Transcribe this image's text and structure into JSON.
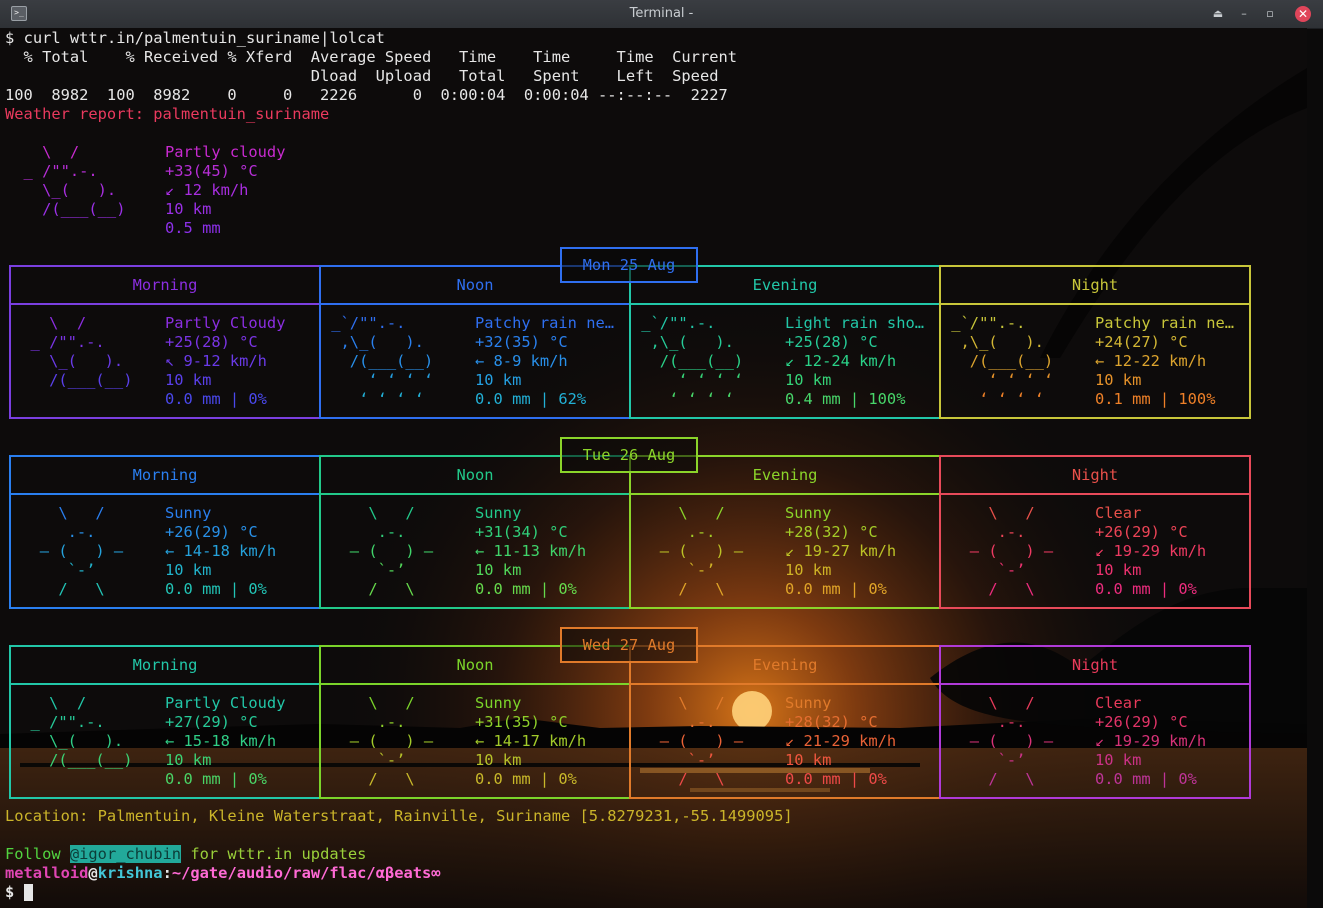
{
  "window": {
    "title": "Terminal -",
    "icon": "terminal-icon",
    "buttons": [
      "up-arrow-icon",
      "minimize-icon",
      "maximize-icon",
      "close-icon"
    ],
    "button_glyphs": [
      "⏏",
      "–",
      "▫",
      "✕"
    ]
  },
  "command": {
    "prompt_symbol": "$",
    "text": "curl wttr.in/palmentuin_suriname|lolcat"
  },
  "curl_progress": {
    "header1": "  % Total    % Received % Xferd  Average Speed   Time    Time     Time  Current",
    "header2": "                                 Dload  Upload   Total   Spent    Left  Speed",
    "values": "100  8982  100  8982    0     0   2226      0  0:00:04  0:00:04 --:--:--  2227"
  },
  "report_title": "Weather report: palmentuin_suriname",
  "current": {
    "art": [
      "    \\  /",
      "  _ /\"\".-.",
      "    \\_(   ).",
      "    /(___(__)"
    ],
    "condition": "Partly cloudy",
    "temperature": "+33(45) °C",
    "wind": "↙ 12 km/h",
    "visibility": "10 km",
    "precipitation": "0.5 mm"
  },
  "forecast": {
    "periods": [
      "Morning",
      "Noon",
      "Evening",
      "Night"
    ],
    "days": [
      {
        "date": "Mon 25 Aug",
        "cells": [
          {
            "art": [
              "    \\  /",
              "  _ /\"\".-.",
              "    \\_(   ).",
              "    /(___(__)",
              ""
            ],
            "lines": [
              "Partly Cloudy",
              "+25(28) °C",
              "↖ 9-12 km/h",
              "10 km",
              "0.0 mm | 0%"
            ]
          },
          {
            "art": [
              " _`/\"\".-.",
              "  ,\\_(   ).",
              "   /(___(__)",
              "     ‘ ‘ ‘ ‘",
              "    ‘ ‘ ‘ ‘"
            ],
            "lines": [
              "Patchy rain ne…",
              "+32(35) °C",
              "← 8-9 km/h",
              "10 km",
              "0.0 mm | 62%"
            ]
          },
          {
            "art": [
              " _`/\"\".-.",
              "  ,\\_(   ).",
              "   /(___(__)",
              "     ‘ ‘ ‘ ‘",
              "    ‘ ‘ ‘ ‘"
            ],
            "lines": [
              "Light rain sho…",
              "+25(28) °C",
              "↙ 12-24 km/h",
              "10 km",
              "0.4 mm | 100%"
            ]
          },
          {
            "art": [
              " _`/\"\".-.",
              "  ,\\_(   ).",
              "   /(___(__)",
              "     ‘ ‘ ‘ ‘",
              "    ‘ ‘ ‘ ‘"
            ],
            "lines": [
              "Patchy rain ne…",
              "+24(27) °C",
              "← 12-22 km/h",
              "10 km",
              "0.1 mm | 100%"
            ]
          }
        ]
      },
      {
        "date": "Tue 26 Aug",
        "cells": [
          {
            "art": [
              "     \\   /",
              "      .-.",
              "   ― (   ) ―",
              "      `-’",
              "     /   \\"
            ],
            "lines": [
              "Sunny",
              "+26(29) °C",
              "← 14-18 km/h",
              "10 km",
              "0.0 mm | 0%"
            ]
          },
          {
            "art": [
              "     \\   /",
              "      .-.",
              "   ― (   ) ―",
              "      `-’",
              "     /   \\"
            ],
            "lines": [
              "Sunny",
              "+31(34) °C",
              "← 11-13 km/h",
              "10 km",
              "0.0 mm | 0%"
            ]
          },
          {
            "art": [
              "     \\   /",
              "      .-.",
              "   ― (   ) ―",
              "      `-’",
              "     /   \\"
            ],
            "lines": [
              "Sunny",
              "+28(32) °C",
              "↙ 19-27 km/h",
              "10 km",
              "0.0 mm | 0%"
            ]
          },
          {
            "art": [
              "     \\   /",
              "      .-.",
              "   ― (   ) ―",
              "      `-’",
              "     /   \\"
            ],
            "lines": [
              "Clear",
              "+26(29) °C",
              "↙ 19-29 km/h",
              "10 km",
              "0.0 mm | 0%"
            ]
          }
        ]
      },
      {
        "date": "Wed 27 Aug",
        "cells": [
          {
            "art": [
              "    \\  /",
              "  _ /\"\".-.",
              "    \\_(   ).",
              "    /(___(__)",
              ""
            ],
            "lines": [
              "Partly Cloudy",
              "+27(29) °C",
              "← 15-18 km/h",
              "10 km",
              "0.0 mm | 0%"
            ]
          },
          {
            "art": [
              "     \\   /",
              "      .-.",
              "   ― (   ) ―",
              "      `-’",
              "     /   \\"
            ],
            "lines": [
              "Sunny",
              "+31(35) °C",
              "← 14-17 km/h",
              "10 km",
              "0.0 mm | 0%"
            ]
          },
          {
            "art": [
              "     \\   /",
              "      .-.",
              "   ― (   ) ―",
              "      `-’",
              "     /   \\"
            ],
            "lines": [
              "Sunny",
              "+28(32) °C",
              "↙ 21-29 km/h",
              "10 km",
              "0.0 mm | 0%"
            ]
          },
          {
            "art": [
              "     \\   /",
              "      .-.",
              "   ― (   ) ―",
              "      `-’",
              "     /   \\"
            ],
            "lines": [
              "Clear",
              "+26(29) °C",
              "↙ 19-29 km/h",
              "10 km",
              "0.0 mm | 0%"
            ]
          }
        ]
      }
    ]
  },
  "location_line": "Location: Palmentuin, Kleine Waterstraat, Rainville, Suriname [5.8279231,-55.1499095]",
  "follow": {
    "prefix": "Follow ",
    "handle": "@igor_chubin",
    "suffix": " for wttr.in updates"
  },
  "prompt": {
    "user": "metalloid",
    "at": "@",
    "host": "krishna",
    "colon": ":",
    "path": "~/gate/audio/raw/flac/αβeats∞",
    "symbol": "$"
  },
  "colors": {
    "background": "#0b0a0a",
    "titlebar": "#2e3135",
    "close_button": "#e0455a",
    "handle_highlight": "#22a99a",
    "table_border_day1": [
      "#7a3fe0",
      "#2f6ff0",
      "#22c7a8",
      "#c8c63a"
    ],
    "table_border_day2": [
      "#2a7ff0",
      "#22c98a",
      "#8bd42a",
      "#e84a5a"
    ],
    "table_border_day3": [
      "#22c7a8",
      "#7bd42a",
      "#e07a2a",
      "#b03ad8"
    ]
  }
}
